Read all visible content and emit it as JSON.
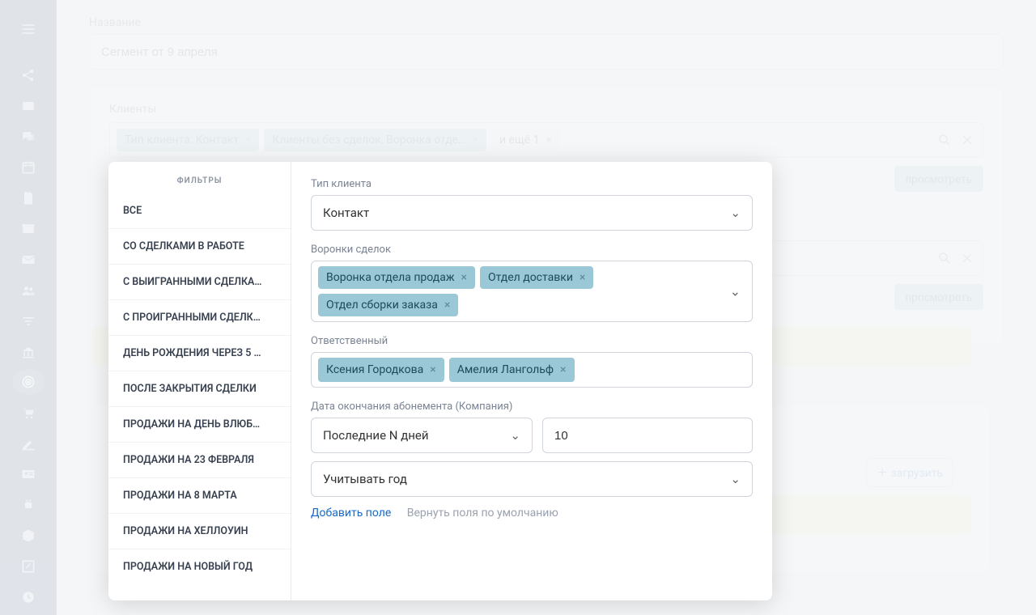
{
  "sidebar": {
    "items": [
      {
        "name": "hamburger-icon"
      },
      {
        "name": "share-icon"
      },
      {
        "name": "card-icon"
      },
      {
        "name": "chat-icon"
      },
      {
        "name": "calendar-icon"
      },
      {
        "name": "doc-icon"
      },
      {
        "name": "archive-icon"
      },
      {
        "name": "mail-icon"
      },
      {
        "name": "people-icon"
      },
      {
        "name": "filter-icon"
      },
      {
        "name": "bank-icon"
      },
      {
        "name": "target-icon"
      },
      {
        "name": "cart-icon"
      },
      {
        "name": "pen-icon"
      },
      {
        "name": "idcard-icon"
      },
      {
        "name": "android-icon"
      },
      {
        "name": "cube-icon"
      },
      {
        "name": "edit-icon"
      },
      {
        "name": "clock-icon"
      }
    ]
  },
  "form": {
    "name_label": "Название",
    "name_value": "Сегмент от 9 апреля"
  },
  "clients": {
    "label": "Клиенты",
    "tags": [
      {
        "label": "Тип клиента: Контакт"
      },
      {
        "label": "Клиенты без сделок, Воронка отде…"
      },
      {
        "label": "и ещё 1",
        "plain": true
      }
    ],
    "view_btn": "просмотреть",
    "view_btn2": "просмотреть",
    "load_btn": "загрузить"
  },
  "filter_panel": {
    "title": "ФИЛЬТРЫ",
    "items": [
      "ВСЕ",
      "СО СДЕЛКАМИ В РАБОТЕ",
      "С ВЫИГРАННЫМИ СДЕЛКА…",
      "С ПРОИГРАННЫМИ СДЕЛК…",
      "ДЕНЬ РОЖДЕНИЯ ЧЕРЕЗ 5 …",
      "ПОСЛЕ ЗАКРЫТИЯ СДЕЛКИ",
      "ПРОДАЖИ НА ДЕНЬ ВЛЮБ…",
      "ПРОДАЖИ НА 23 ФЕВРАЛЯ",
      "ПРОДАЖИ НА 8 МАРТА",
      "ПРОДАЖИ НА ХЕЛЛОУИН",
      "ПРОДАЖИ НА НОВЫЙ ГОД"
    ],
    "client_type_label": "Тип клиента",
    "client_type_value": "Контакт",
    "funnels_label": "Воронки сделок",
    "funnel_tags": [
      "Воронка отдела продаж",
      "Отдел доставки",
      "Отдел сборки заказа"
    ],
    "responsible_label": "Ответственный",
    "responsible_tags": [
      "Ксения Городкова",
      "Амелия Лангольф"
    ],
    "sub_end_label": "Дата окончания абонемента (Компания)",
    "period_value": "Последние N дней",
    "period_n": "10",
    "year_mode": "Учитывать год",
    "add_field": "Добавить поле",
    "reset_fields": "Вернуть поля по умолчанию"
  }
}
